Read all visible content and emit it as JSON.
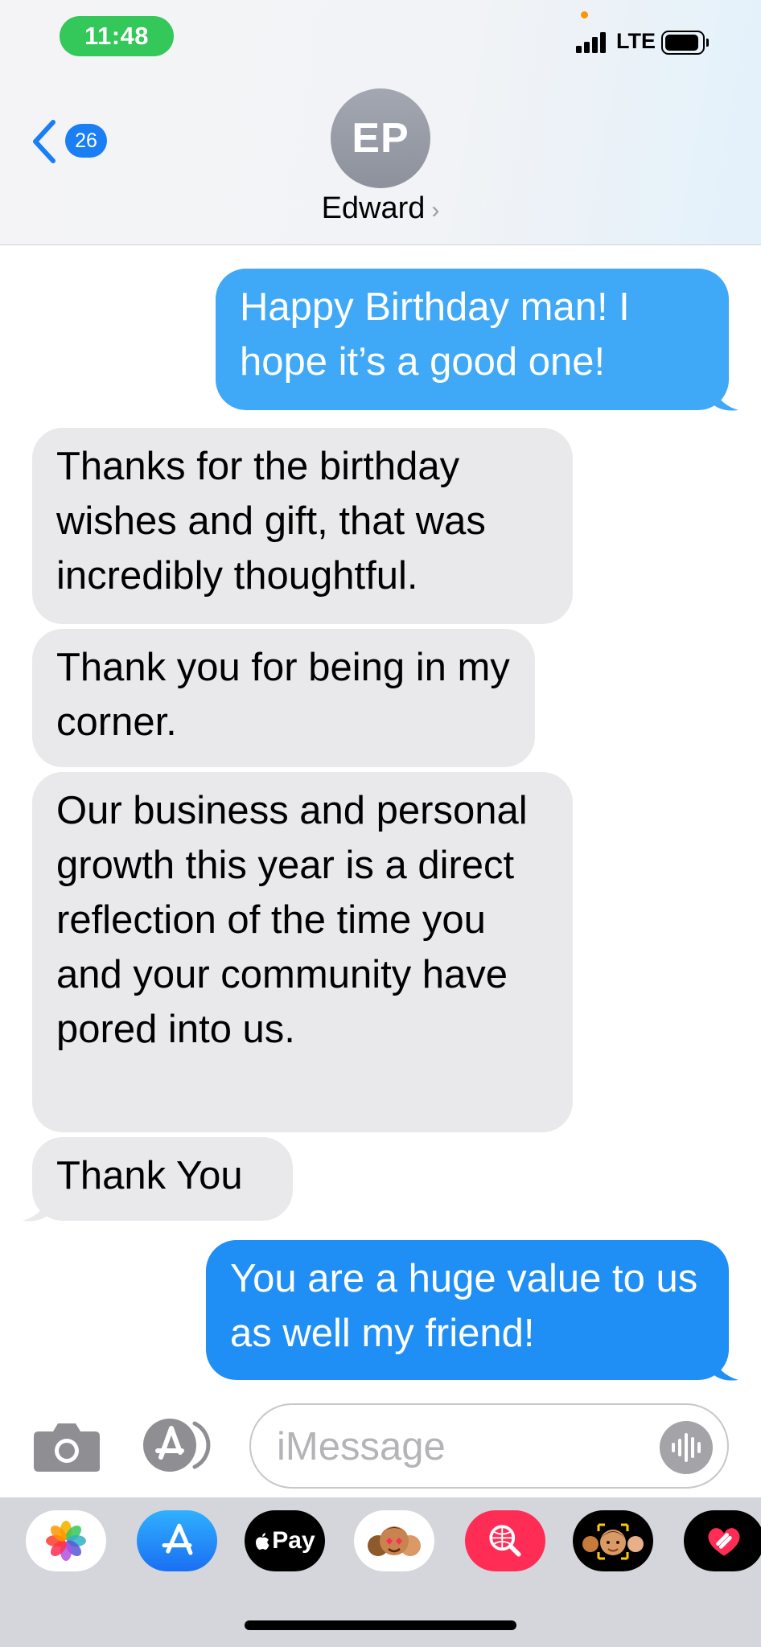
{
  "status_bar": {
    "time": "11:48",
    "network": "LTE"
  },
  "header": {
    "back_badge_count": "26",
    "contact_initials": "EP",
    "contact_name": "Edward",
    "contact_chevron": "›"
  },
  "messages": [
    {
      "direction": "sent",
      "text": "Happy Birthday man!  I hope it’s a good one!"
    },
    {
      "direction": "received",
      "text": "Thanks for the birthday wishes and gift, that was incredibly thoughtful."
    },
    {
      "direction": "received",
      "text": "Thank you for being in my corner."
    },
    {
      "direction": "received",
      "text": "Our business and personal growth this year is a direct reflection of the time you and your community have pored into us."
    },
    {
      "direction": "received",
      "text": "Thank You"
    },
    {
      "direction": "sent",
      "text": "You are a huge value to us as well my friend!"
    }
  ],
  "input_bar": {
    "placeholder": "iMessage",
    "value": ""
  },
  "app_drawer": {
    "apps": [
      {
        "name": "photos-app-icon"
      },
      {
        "name": "app-store-app-icon"
      },
      {
        "name": "apple-pay-app-icon",
        "label": "Pay"
      },
      {
        "name": "memoji-stickers-app-icon"
      },
      {
        "name": "image-search-app-icon"
      },
      {
        "name": "memoji-app-icon"
      },
      {
        "name": "digital-touch-app-icon"
      }
    ]
  },
  "colors": {
    "sent_bubble": "#1f8ef5",
    "sent_bubble_first": "#3fa9f7",
    "received_bubble": "#e9e9eb",
    "time_pill": "#34c759",
    "accent": "#1a7ef5"
  }
}
